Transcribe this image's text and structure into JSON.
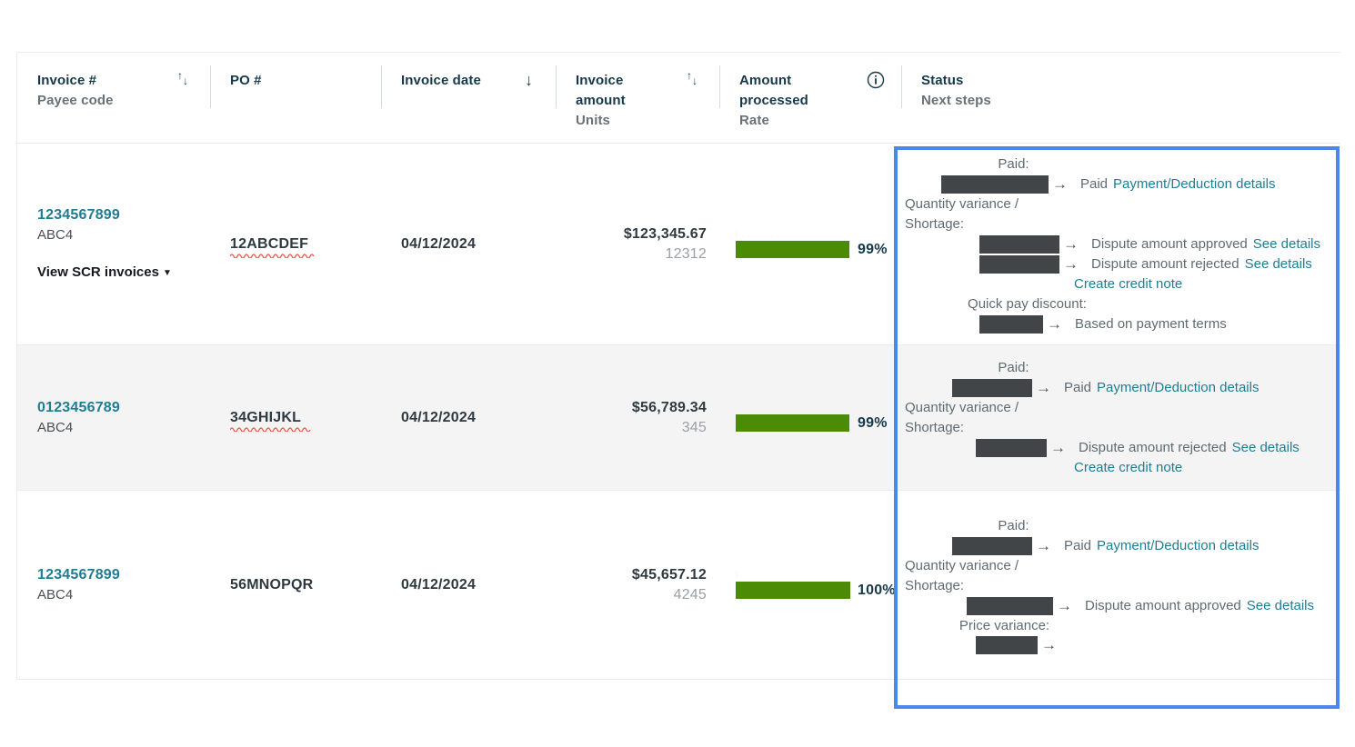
{
  "table": {
    "columns": [
      {
        "id": "invoice",
        "main": "Invoice #",
        "sub": "Payee code",
        "sort": "sort-both-icon"
      },
      {
        "id": "po",
        "main": "PO #",
        "sub": "",
        "sort": ""
      },
      {
        "id": "date",
        "main": "Invoice date",
        "sub": "",
        "sort": "sort-desc-icon"
      },
      {
        "id": "amount",
        "main": "Invoice\namount",
        "sub": "Units",
        "sort": "sort-both-icon"
      },
      {
        "id": "processed",
        "main": "Amount\nprocessed",
        "sub": "Rate",
        "sort": "info-icon"
      },
      {
        "id": "status",
        "main": "Status",
        "sub": "Next steps",
        "sort": ""
      }
    ],
    "headers": {
      "invoice_main": "Invoice #",
      "invoice_sub": "Payee code",
      "po_main": "PO #",
      "date_main": "Invoice date",
      "amount_main_1": "Invoice",
      "amount_main_2": "amount",
      "amount_sub": "Units",
      "processed_main_1": "Amount",
      "processed_main_2": "processed",
      "processed_sub": "Rate",
      "status_main": "Status",
      "status_sub": "Next steps"
    },
    "rows": [
      {
        "invoice_number": "1234567899",
        "payee_code": "ABC4",
        "scr_link": "View SCR invoices",
        "scr_caret": "▼",
        "po_number": "12ABCDEF",
        "po_misspelled": true,
        "invoice_date": "04/12/2024",
        "invoice_amount": "$123,345.67",
        "units": "12312",
        "rate_percent": "99%",
        "rate_value": 99,
        "status_items": [
          {
            "label": "Paid:",
            "label_align": "center",
            "redact_width": 118,
            "redact_indent": 40,
            "text": "Paid",
            "link": "Payment/Deduction details",
            "sub_link": ""
          },
          {
            "label": "Quantity variance /\nShortage:",
            "label_align": "left",
            "redact_width": 88,
            "redact_indent": 82,
            "text": "Dispute amount approved",
            "link": "See details",
            "sub_link": ""
          },
          {
            "label": "",
            "label_align": "left",
            "redact_width": 88,
            "redact_indent": 82,
            "text": "Dispute amount rejected",
            "link": "See details",
            "sub_link": "Create credit note"
          },
          {
            "label": "Quick pay discount:",
            "label_align": "center",
            "redact_width": 70,
            "redact_indent": 82,
            "text": "Based on payment terms",
            "link": "",
            "sub_link": ""
          }
        ]
      },
      {
        "invoice_number": "0123456789",
        "payee_code": "ABC4",
        "scr_link": "",
        "scr_caret": "",
        "po_number": "34GHIJKL",
        "po_misspelled": true,
        "invoice_date": "04/12/2024",
        "invoice_amount": "$56,789.34",
        "units": "345",
        "rate_percent": "99%",
        "rate_value": 99,
        "status_items": [
          {
            "label": "Paid:",
            "label_align": "center",
            "redact_width": 88,
            "redact_indent": 52,
            "text": "Paid",
            "link": "Payment/Deduction details",
            "sub_link": ""
          },
          {
            "label": "Quantity variance /\nShortage:",
            "label_align": "left",
            "redact_width": 78,
            "redact_indent": 78,
            "text": "Dispute amount rejected",
            "link": "See details",
            "sub_link": "Create credit note"
          }
        ]
      },
      {
        "invoice_number": "1234567899",
        "payee_code": "ABC4",
        "scr_link": "",
        "scr_caret": "",
        "po_number": "56MNOPQR",
        "po_misspelled": false,
        "invoice_date": "04/12/2024",
        "invoice_amount": "$45,657.12",
        "units": "4245",
        "rate_percent": "100%",
        "rate_value": 100,
        "status_items": [
          {
            "label": "Paid:",
            "label_align": "center",
            "redact_width": 88,
            "redact_indent": 52,
            "text": "Paid",
            "link": "Payment/Deduction details",
            "sub_link": ""
          },
          {
            "label": "Quantity variance /\nShortage:",
            "label_align": "left",
            "redact_width": 95,
            "redact_indent": 68,
            "text": "Dispute amount approved",
            "link": "See details",
            "sub_link": ""
          },
          {
            "label": "Price variance:",
            "label_align": "center",
            "redact_width": 68,
            "redact_indent": 78,
            "text": "",
            "link": "",
            "sub_link": ""
          }
        ]
      }
    ]
  },
  "colors": {
    "link": "#1f7d93",
    "header_text": "#16394a",
    "muted": "#687078",
    "progress_bar": "#4c8b06",
    "highlight_border": "#4a89ea",
    "redaction": "#424548",
    "row_alt_bg": "#f4f4f4"
  },
  "icons": {
    "sort_both": "⇅",
    "sort_desc": "↓",
    "info": "ⓘ",
    "arrow_right": "→"
  }
}
